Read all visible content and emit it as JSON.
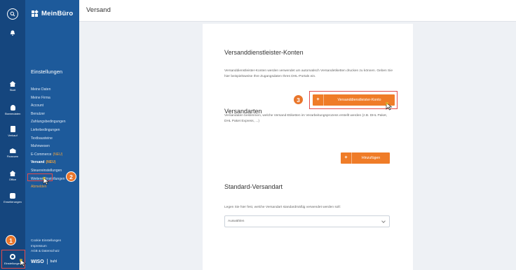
{
  "rail": {
    "items": [
      {
        "label": "Start",
        "icon": "home-icon"
      },
      {
        "label": "Stammdaten",
        "icon": "person-icon"
      },
      {
        "label": "Verkauf",
        "icon": "document-icon"
      },
      {
        "label": "Finanzen",
        "icon": "bank-icon"
      },
      {
        "label": "Office",
        "icon": "house-icon"
      },
      {
        "label": "Erweiterungen",
        "icon": "puzzle-icon"
      }
    ],
    "settings_label": "Einstellungen"
  },
  "sidebar": {
    "logo": "MeinBüro",
    "title": "Einstellungen",
    "items": [
      {
        "label": "Meine Daten"
      },
      {
        "label": "Meine Firma"
      },
      {
        "label": "Account"
      },
      {
        "label": "Benutzer"
      },
      {
        "label": "Zahlungsbedingungen"
      },
      {
        "label": "Lieferbedingungen"
      },
      {
        "label": "Textbausteine"
      },
      {
        "label": "Mahnwesen"
      },
      {
        "label": "E-Commerce",
        "badge": "(NEU)"
      },
      {
        "label": "Versand",
        "badge": "(NEU)"
      },
      {
        "label": "Steuereinstellungen"
      },
      {
        "label": "Weitere Einstellungen"
      },
      {
        "label": "Abmelden"
      }
    ],
    "footer": [
      "Cookie Einstellungen",
      "Impressum",
      "AGB & Datenschutz"
    ],
    "brand_wiso": "WISO",
    "brand_buhl": "buhl"
  },
  "badges": [
    "1",
    "2",
    "3"
  ],
  "header": {
    "title": "Versand"
  },
  "main": {
    "section1": {
      "title": "Versanddienstleister-Konten",
      "text": "Versanddienstleister-Konten werden verwendet um automatisch Versandetiketten drucken zu können. Geben Sie hier beispielsweise Ihre Zugangsdaten Ihres DHL-Portals ein.",
      "button_plus": "+",
      "button_label": "Versanddienstleister-Konto"
    },
    "section2": {
      "title": "Versandarten",
      "text": "Versandaten bestimmen, welche Versand-Etiketten im Verarbeitungsprozess erstellt werden (z.B. DHL Paket, DHL Paket Express, ...)",
      "button_plus": "+",
      "button_label": "Hinzufügen"
    },
    "section3": {
      "title": "Standard-Versandart",
      "text": "Legen Sie hier fest, welche Versandart standardmäßig verwendet werden soll:",
      "select_value": "Auswählen"
    }
  },
  "colors": {
    "rail": "#15467e",
    "sidebar": "#1d5a9b",
    "accent": "#ef7c28",
    "highlight": "#e24b4b"
  }
}
